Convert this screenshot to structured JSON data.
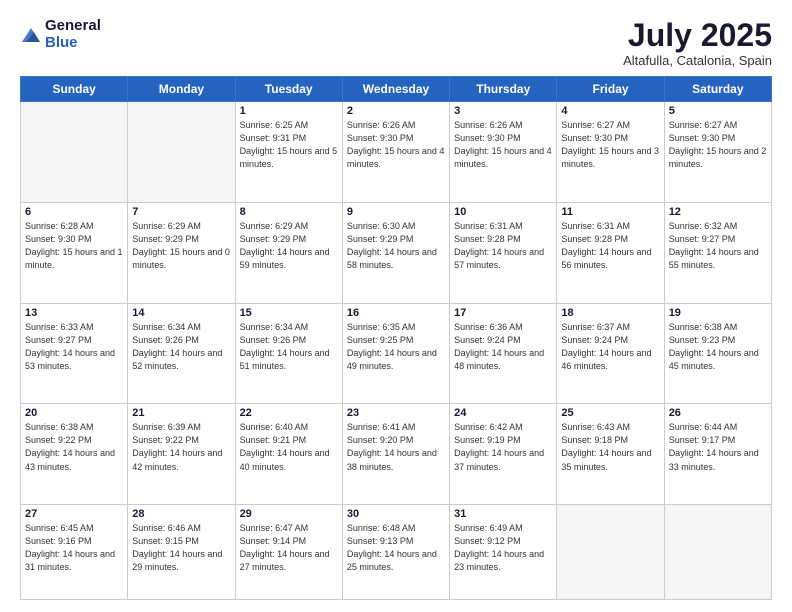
{
  "header": {
    "logo_general": "General",
    "logo_blue": "Blue",
    "month_title": "July 2025",
    "location": "Altafulla, Catalonia, Spain"
  },
  "days_of_week": [
    "Sunday",
    "Monday",
    "Tuesday",
    "Wednesday",
    "Thursday",
    "Friday",
    "Saturday"
  ],
  "weeks": [
    [
      {
        "num": "",
        "sunrise": "",
        "sunset": "",
        "daylight": "",
        "empty": true
      },
      {
        "num": "",
        "sunrise": "",
        "sunset": "",
        "daylight": "",
        "empty": true
      },
      {
        "num": "1",
        "sunrise": "Sunrise: 6:25 AM",
        "sunset": "Sunset: 9:31 PM",
        "daylight": "Daylight: 15 hours and 5 minutes."
      },
      {
        "num": "2",
        "sunrise": "Sunrise: 6:26 AM",
        "sunset": "Sunset: 9:30 PM",
        "daylight": "Daylight: 15 hours and 4 minutes."
      },
      {
        "num": "3",
        "sunrise": "Sunrise: 6:26 AM",
        "sunset": "Sunset: 9:30 PM",
        "daylight": "Daylight: 15 hours and 4 minutes."
      },
      {
        "num": "4",
        "sunrise": "Sunrise: 6:27 AM",
        "sunset": "Sunset: 9:30 PM",
        "daylight": "Daylight: 15 hours and 3 minutes."
      },
      {
        "num": "5",
        "sunrise": "Sunrise: 6:27 AM",
        "sunset": "Sunset: 9:30 PM",
        "daylight": "Daylight: 15 hours and 2 minutes."
      }
    ],
    [
      {
        "num": "6",
        "sunrise": "Sunrise: 6:28 AM",
        "sunset": "Sunset: 9:30 PM",
        "daylight": "Daylight: 15 hours and 1 minute."
      },
      {
        "num": "7",
        "sunrise": "Sunrise: 6:29 AM",
        "sunset": "Sunset: 9:29 PM",
        "daylight": "Daylight: 15 hours and 0 minutes."
      },
      {
        "num": "8",
        "sunrise": "Sunrise: 6:29 AM",
        "sunset": "Sunset: 9:29 PM",
        "daylight": "Daylight: 14 hours and 59 minutes."
      },
      {
        "num": "9",
        "sunrise": "Sunrise: 6:30 AM",
        "sunset": "Sunset: 9:29 PM",
        "daylight": "Daylight: 14 hours and 58 minutes."
      },
      {
        "num": "10",
        "sunrise": "Sunrise: 6:31 AM",
        "sunset": "Sunset: 9:28 PM",
        "daylight": "Daylight: 14 hours and 57 minutes."
      },
      {
        "num": "11",
        "sunrise": "Sunrise: 6:31 AM",
        "sunset": "Sunset: 9:28 PM",
        "daylight": "Daylight: 14 hours and 56 minutes."
      },
      {
        "num": "12",
        "sunrise": "Sunrise: 6:32 AM",
        "sunset": "Sunset: 9:27 PM",
        "daylight": "Daylight: 14 hours and 55 minutes."
      }
    ],
    [
      {
        "num": "13",
        "sunrise": "Sunrise: 6:33 AM",
        "sunset": "Sunset: 9:27 PM",
        "daylight": "Daylight: 14 hours and 53 minutes."
      },
      {
        "num": "14",
        "sunrise": "Sunrise: 6:34 AM",
        "sunset": "Sunset: 9:26 PM",
        "daylight": "Daylight: 14 hours and 52 minutes."
      },
      {
        "num": "15",
        "sunrise": "Sunrise: 6:34 AM",
        "sunset": "Sunset: 9:26 PM",
        "daylight": "Daylight: 14 hours and 51 minutes."
      },
      {
        "num": "16",
        "sunrise": "Sunrise: 6:35 AM",
        "sunset": "Sunset: 9:25 PM",
        "daylight": "Daylight: 14 hours and 49 minutes."
      },
      {
        "num": "17",
        "sunrise": "Sunrise: 6:36 AM",
        "sunset": "Sunset: 9:24 PM",
        "daylight": "Daylight: 14 hours and 48 minutes."
      },
      {
        "num": "18",
        "sunrise": "Sunrise: 6:37 AM",
        "sunset": "Sunset: 9:24 PM",
        "daylight": "Daylight: 14 hours and 46 minutes."
      },
      {
        "num": "19",
        "sunrise": "Sunrise: 6:38 AM",
        "sunset": "Sunset: 9:23 PM",
        "daylight": "Daylight: 14 hours and 45 minutes."
      }
    ],
    [
      {
        "num": "20",
        "sunrise": "Sunrise: 6:38 AM",
        "sunset": "Sunset: 9:22 PM",
        "daylight": "Daylight: 14 hours and 43 minutes."
      },
      {
        "num": "21",
        "sunrise": "Sunrise: 6:39 AM",
        "sunset": "Sunset: 9:22 PM",
        "daylight": "Daylight: 14 hours and 42 minutes."
      },
      {
        "num": "22",
        "sunrise": "Sunrise: 6:40 AM",
        "sunset": "Sunset: 9:21 PM",
        "daylight": "Daylight: 14 hours and 40 minutes."
      },
      {
        "num": "23",
        "sunrise": "Sunrise: 6:41 AM",
        "sunset": "Sunset: 9:20 PM",
        "daylight": "Daylight: 14 hours and 38 minutes."
      },
      {
        "num": "24",
        "sunrise": "Sunrise: 6:42 AM",
        "sunset": "Sunset: 9:19 PM",
        "daylight": "Daylight: 14 hours and 37 minutes."
      },
      {
        "num": "25",
        "sunrise": "Sunrise: 6:43 AM",
        "sunset": "Sunset: 9:18 PM",
        "daylight": "Daylight: 14 hours and 35 minutes."
      },
      {
        "num": "26",
        "sunrise": "Sunrise: 6:44 AM",
        "sunset": "Sunset: 9:17 PM",
        "daylight": "Daylight: 14 hours and 33 minutes."
      }
    ],
    [
      {
        "num": "27",
        "sunrise": "Sunrise: 6:45 AM",
        "sunset": "Sunset: 9:16 PM",
        "daylight": "Daylight: 14 hours and 31 minutes."
      },
      {
        "num": "28",
        "sunrise": "Sunrise: 6:46 AM",
        "sunset": "Sunset: 9:15 PM",
        "daylight": "Daylight: 14 hours and 29 minutes."
      },
      {
        "num": "29",
        "sunrise": "Sunrise: 6:47 AM",
        "sunset": "Sunset: 9:14 PM",
        "daylight": "Daylight: 14 hours and 27 minutes."
      },
      {
        "num": "30",
        "sunrise": "Sunrise: 6:48 AM",
        "sunset": "Sunset: 9:13 PM",
        "daylight": "Daylight: 14 hours and 25 minutes."
      },
      {
        "num": "31",
        "sunrise": "Sunrise: 6:49 AM",
        "sunset": "Sunset: 9:12 PM",
        "daylight": "Daylight: 14 hours and 23 minutes."
      },
      {
        "num": "",
        "sunrise": "",
        "sunset": "",
        "daylight": "",
        "empty": true
      },
      {
        "num": "",
        "sunrise": "",
        "sunset": "",
        "daylight": "",
        "empty": true
      }
    ]
  ]
}
